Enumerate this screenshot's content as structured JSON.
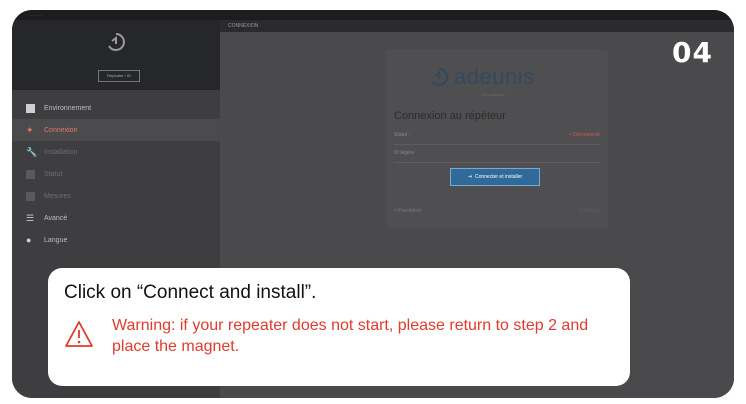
{
  "step_number": "04",
  "app": {
    "top_caption": "...........",
    "serial": "Repeater / ID",
    "breadcrumb": "CONNEXION",
    "nav": [
      {
        "label": "Environnement",
        "state": "normal"
      },
      {
        "label": "Connexion",
        "state": "active"
      },
      {
        "label": "Installation",
        "state": "dim"
      },
      {
        "label": "Statut",
        "state": "dim"
      },
      {
        "label": "Mesures",
        "state": "dim"
      },
      {
        "label": "Avancé",
        "state": "normal"
      },
      {
        "label": "Langue",
        "state": "normal"
      }
    ]
  },
  "card": {
    "brand": "adeunis",
    "brand_sub": "IoT solutions",
    "title": "Connexion au répéteur",
    "status_label": "Statut :",
    "status_value": "× Déconnecté",
    "id_label": "ID légère",
    "id_value": "",
    "connect_button": "Connecter et installer",
    "prev": "< Précédent",
    "next": "Continuer"
  },
  "callout": {
    "instruction": "Click on “Connect and install”.",
    "warning": "Warning: if your repeater does not start, please return to step 2 and place the magnet."
  },
  "colors": {
    "accent": "#e07a5f",
    "warning": "#e23a2c",
    "button": "#2f6a9a"
  }
}
